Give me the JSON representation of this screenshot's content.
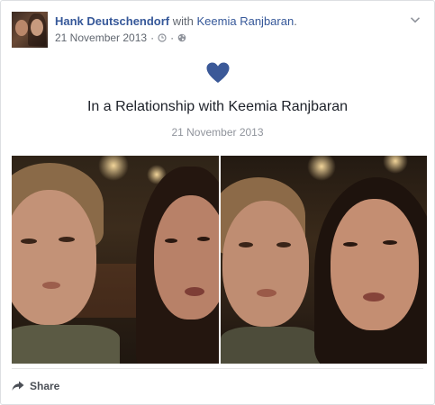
{
  "post": {
    "author": "Hank Deutschendorf",
    "with_text": "with",
    "with_name": "Keemia Ranjbaran",
    "with_suffix": ".",
    "date": "21 November 2013",
    "meta_separator": "·",
    "icons": [
      "clock-icon",
      "globe-icon",
      "chevron-down-icon"
    ]
  },
  "life_event": {
    "icon": "heart-icon",
    "icon_color": "#3b5998",
    "title": "In a Relationship with Keemia Ranjbaran",
    "date": "21 November 2013"
  },
  "photos": {
    "count": 2
  },
  "actions": {
    "share_label": "Share"
  },
  "colors": {
    "link": "#365899",
    "meta": "#616770",
    "muted": "#90949c"
  }
}
